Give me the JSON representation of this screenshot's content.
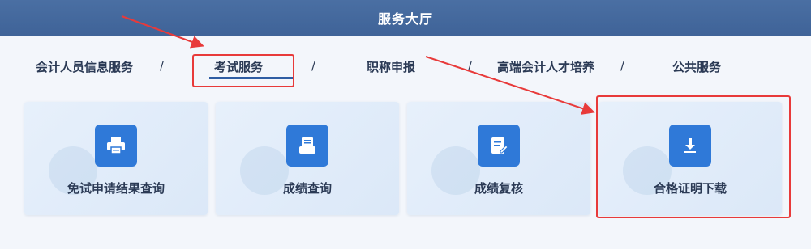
{
  "header": {
    "title": "服务大厅"
  },
  "tabs": [
    {
      "label": "会计人员信息服务"
    },
    {
      "label": "考试服务"
    },
    {
      "label": "职称申报"
    },
    {
      "label": "高端会计人才培养"
    },
    {
      "label": "公共服务"
    }
  ],
  "separator": "/",
  "cards": [
    {
      "label": "免试申请结果查询",
      "icon": "printer-icon"
    },
    {
      "label": "成绩查询",
      "icon": "document-stack-icon"
    },
    {
      "label": "成绩复核",
      "icon": "edit-document-icon"
    },
    {
      "label": "合格证明下载",
      "icon": "download-icon"
    }
  ],
  "colors": {
    "header_bg": "#4a6fa3",
    "accent": "#2f79d8",
    "annotation_red": "#e83a3a"
  }
}
